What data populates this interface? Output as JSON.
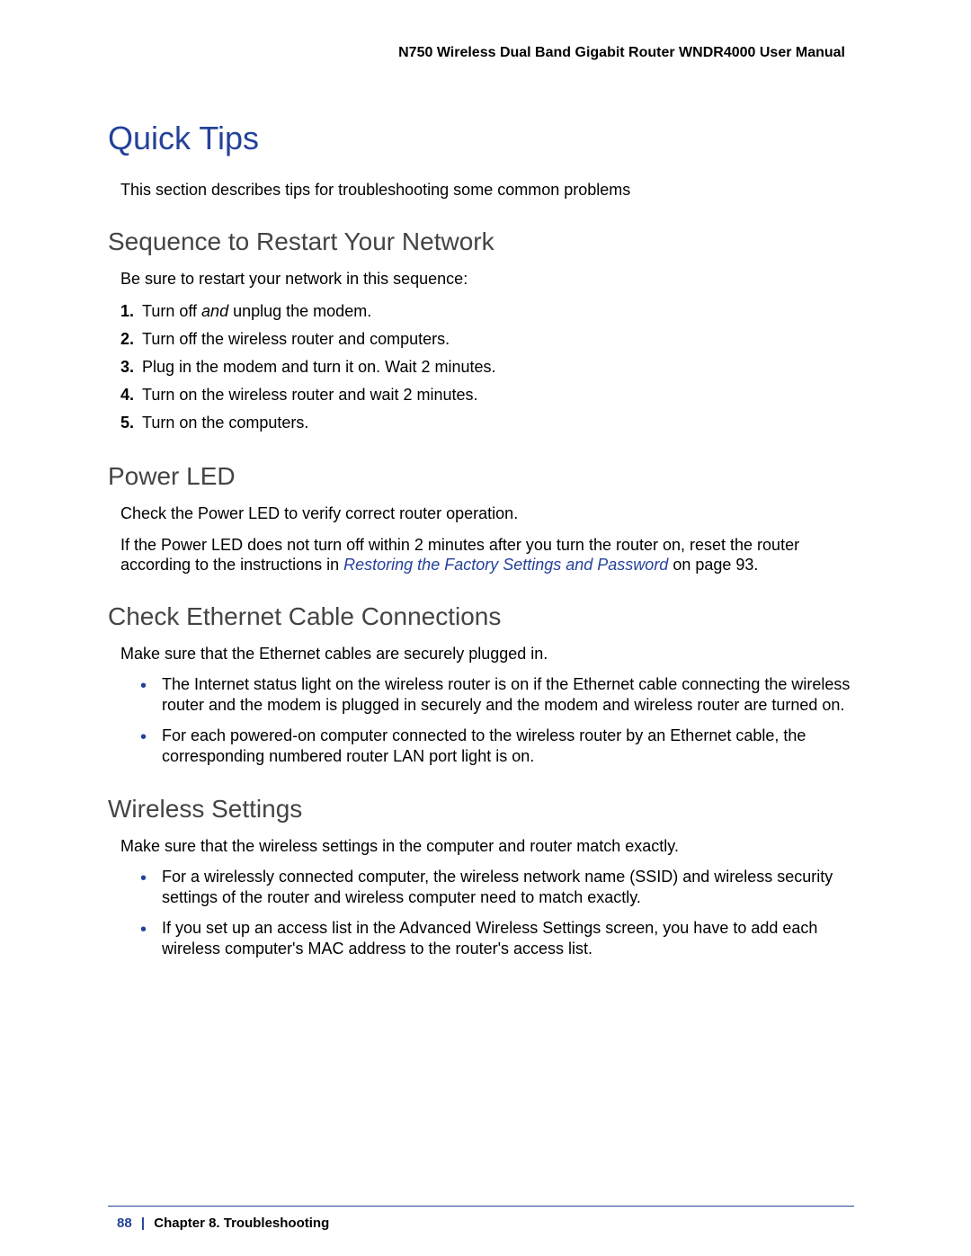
{
  "header": "N750 Wireless Dual Band Gigabit Router WNDR4000 User Manual",
  "h1": "Quick Tips",
  "intro": "This section describes tips for troubleshooting some common problems",
  "sec1": {
    "heading": "Sequence to Restart Your Network",
    "lead": "Be sure to restart your network in this sequence:",
    "steps": [
      {
        "n": "1.",
        "pre": "Turn off ",
        "em": "and",
        "post": " unplug the modem."
      },
      {
        "n": "2.",
        "text": "Turn off the wireless router and computers."
      },
      {
        "n": "3.",
        "text": "Plug in the modem and turn it on. Wait 2 minutes."
      },
      {
        "n": "4.",
        "text": "Turn on the wireless router and wait 2 minutes."
      },
      {
        "n": "5.",
        "text": "Turn on the computers."
      }
    ]
  },
  "sec2": {
    "heading": "Power LED",
    "p1": "Check the Power LED to verify correct router operation.",
    "p2_pre": "If the Power LED does not turn off within 2 minutes after you turn the router on, reset the router according to the instructions in ",
    "p2_link": "Restoring the Factory Settings and Password",
    "p2_post": " on page 93."
  },
  "sec3": {
    "heading": "Check Ethernet Cable Connections",
    "lead": "Make sure that the Ethernet cables are securely plugged in.",
    "bullets": [
      "The Internet status light on the wireless router is on if the Ethernet cable connecting the wireless router and the modem is plugged in securely and the modem and wireless router are turned on.",
      "For each powered-on computer connected to the wireless router by an Ethernet cable, the corresponding numbered router LAN port light is on."
    ]
  },
  "sec4": {
    "heading": "Wireless Settings",
    "lead": "Make sure that the wireless settings in the computer and router match exactly.",
    "bullets": [
      "For a wirelessly connected computer, the wireless network name (SSID) and wireless security settings of the router and wireless computer need to match exactly.",
      "If you set up an access list in the Advanced Wireless Settings screen, you have to add each wireless computer's MAC address to the router's access list."
    ]
  },
  "footer": {
    "page": "88",
    "sep": "|",
    "chapter": "Chapter 8.  Troubleshooting"
  }
}
